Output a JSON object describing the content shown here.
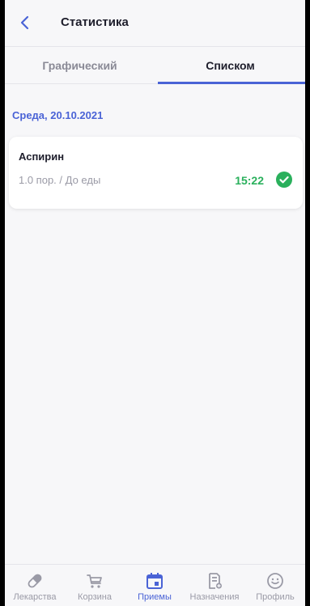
{
  "header": {
    "title": "Статистика",
    "back_icon": "chevron-left-icon"
  },
  "tabs": [
    {
      "label": "Графический",
      "active": false
    },
    {
      "label": "Списком",
      "active": true
    }
  ],
  "date_heading": "Среда, 20.10.2021",
  "intakes": [
    {
      "name": "Аспирин",
      "dose": "1.0 пор. / До еды",
      "time": "15:22",
      "status_icon": "check-circle-icon",
      "status": "taken"
    }
  ],
  "nav": [
    {
      "label": "Лекарства",
      "icon": "pill-icon",
      "active": false
    },
    {
      "label": "Корзина",
      "icon": "cart-icon",
      "active": false
    },
    {
      "label": "Приемы",
      "icon": "calendar-icon",
      "active": true
    },
    {
      "label": "Назначения",
      "icon": "prescription-icon",
      "active": false
    },
    {
      "label": "Профиль",
      "icon": "smile-icon",
      "active": false
    }
  ],
  "colors": {
    "accent": "#4a63d6",
    "success": "#2ab05c",
    "inactive": "#9a9aa6"
  }
}
